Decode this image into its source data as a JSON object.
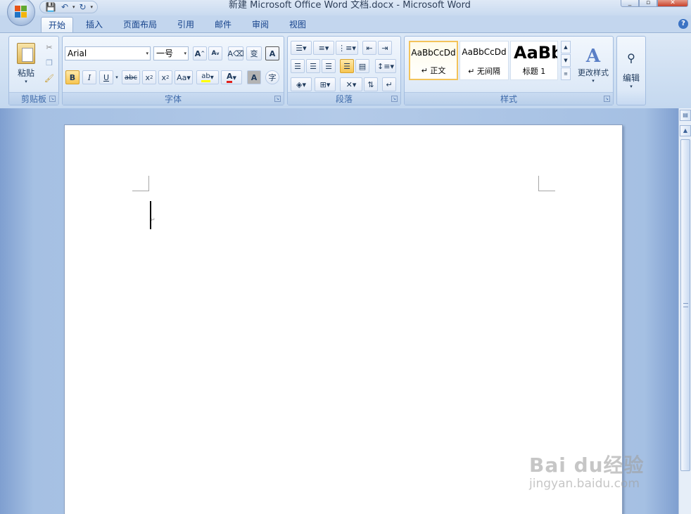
{
  "window": {
    "title": "新建 Microsoft Office Word 文档.docx - Microsoft Word"
  },
  "tabs": [
    {
      "label": "开始",
      "active": true
    },
    {
      "label": "插入"
    },
    {
      "label": "页面布局"
    },
    {
      "label": "引用"
    },
    {
      "label": "邮件"
    },
    {
      "label": "审阅"
    },
    {
      "label": "视图"
    }
  ],
  "ribbon": {
    "clipboard": {
      "label": "剪贴板",
      "paste": "粘贴"
    },
    "font": {
      "label": "字体",
      "family": "Arial",
      "size": "一号",
      "case_button": "Aa",
      "change_case_text": "变"
    },
    "paragraph": {
      "label": "段落"
    },
    "styles": {
      "label": "样式",
      "tiles": [
        {
          "sample": "AaBbCcDd",
          "name": "↵ 正文",
          "selected": true
        },
        {
          "sample": "AaBbCcDd",
          "name": "↵ 无间隔"
        },
        {
          "sample": "AaBb",
          "name": "标题 1"
        }
      ],
      "change_styles": "更改样式"
    },
    "editing": {
      "label": "编辑"
    }
  },
  "watermark": {
    "main": "Bai du经验",
    "sub": "jingyan.baidu.com"
  },
  "colors": {
    "highlight": "#ffff00",
    "font_color": "#e0201b",
    "selected_style_border": "#f3c35a"
  }
}
